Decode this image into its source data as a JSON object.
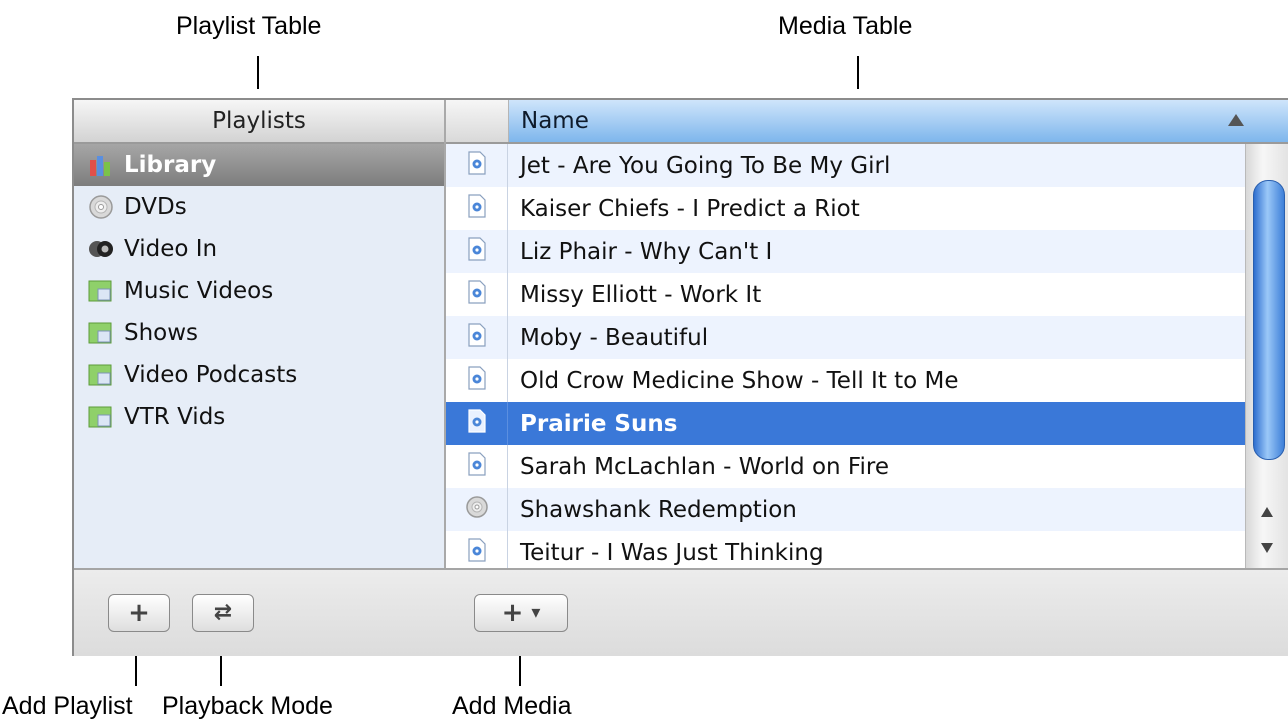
{
  "callouts": {
    "playlist_table": "Playlist Table",
    "media_table": "Media Table",
    "add_playlist": "Add Playlist",
    "playback_mode": "Playback Mode",
    "add_media": "Add Media"
  },
  "playlists": {
    "header": "Playlists",
    "items": [
      {
        "label": "Library",
        "icon": "library-icon",
        "selected": true
      },
      {
        "label": "DVDs",
        "icon": "dvd-icon"
      },
      {
        "label": "Video In",
        "icon": "camera-icon"
      },
      {
        "label": "Music Videos",
        "icon": "playlist-icon"
      },
      {
        "label": "Shows",
        "icon": "playlist-icon"
      },
      {
        "label": "Video Podcasts",
        "icon": "playlist-icon"
      },
      {
        "label": "VTR Vids",
        "icon": "playlist-icon"
      }
    ]
  },
  "media": {
    "column_header": "Name",
    "sort": "ascending",
    "rows": [
      {
        "name": "Jet - Are You Going To Be My Girl",
        "icon": "movie-file-icon"
      },
      {
        "name": "Kaiser Chiefs - I Predict a Riot",
        "icon": "movie-file-icon"
      },
      {
        "name": "Liz Phair - Why Can't I",
        "icon": "movie-file-icon"
      },
      {
        "name": "Missy Elliott - Work It",
        "icon": "movie-file-icon"
      },
      {
        "name": "Moby - Beautiful",
        "icon": "movie-file-icon"
      },
      {
        "name": "Old Crow Medicine Show - Tell It to Me",
        "icon": "movie-file-icon"
      },
      {
        "name": "Prairie Suns",
        "icon": "movie-file-icon",
        "selected": true
      },
      {
        "name": "Sarah McLachlan - World on Fire",
        "icon": "movie-file-icon"
      },
      {
        "name": "Shawshank Redemption",
        "icon": "dvd-icon"
      },
      {
        "name": "Teitur - I Was Just Thinking",
        "icon": "movie-file-icon"
      }
    ]
  },
  "buttons": {
    "add_playlist": "+",
    "playback_mode": "⇄",
    "add_media": "+",
    "add_media_menu": "▾"
  },
  "colors": {
    "selection": "#3a78d8",
    "header_blue": "#7eb6ec",
    "sidebar_bg": "#e6edf7"
  }
}
